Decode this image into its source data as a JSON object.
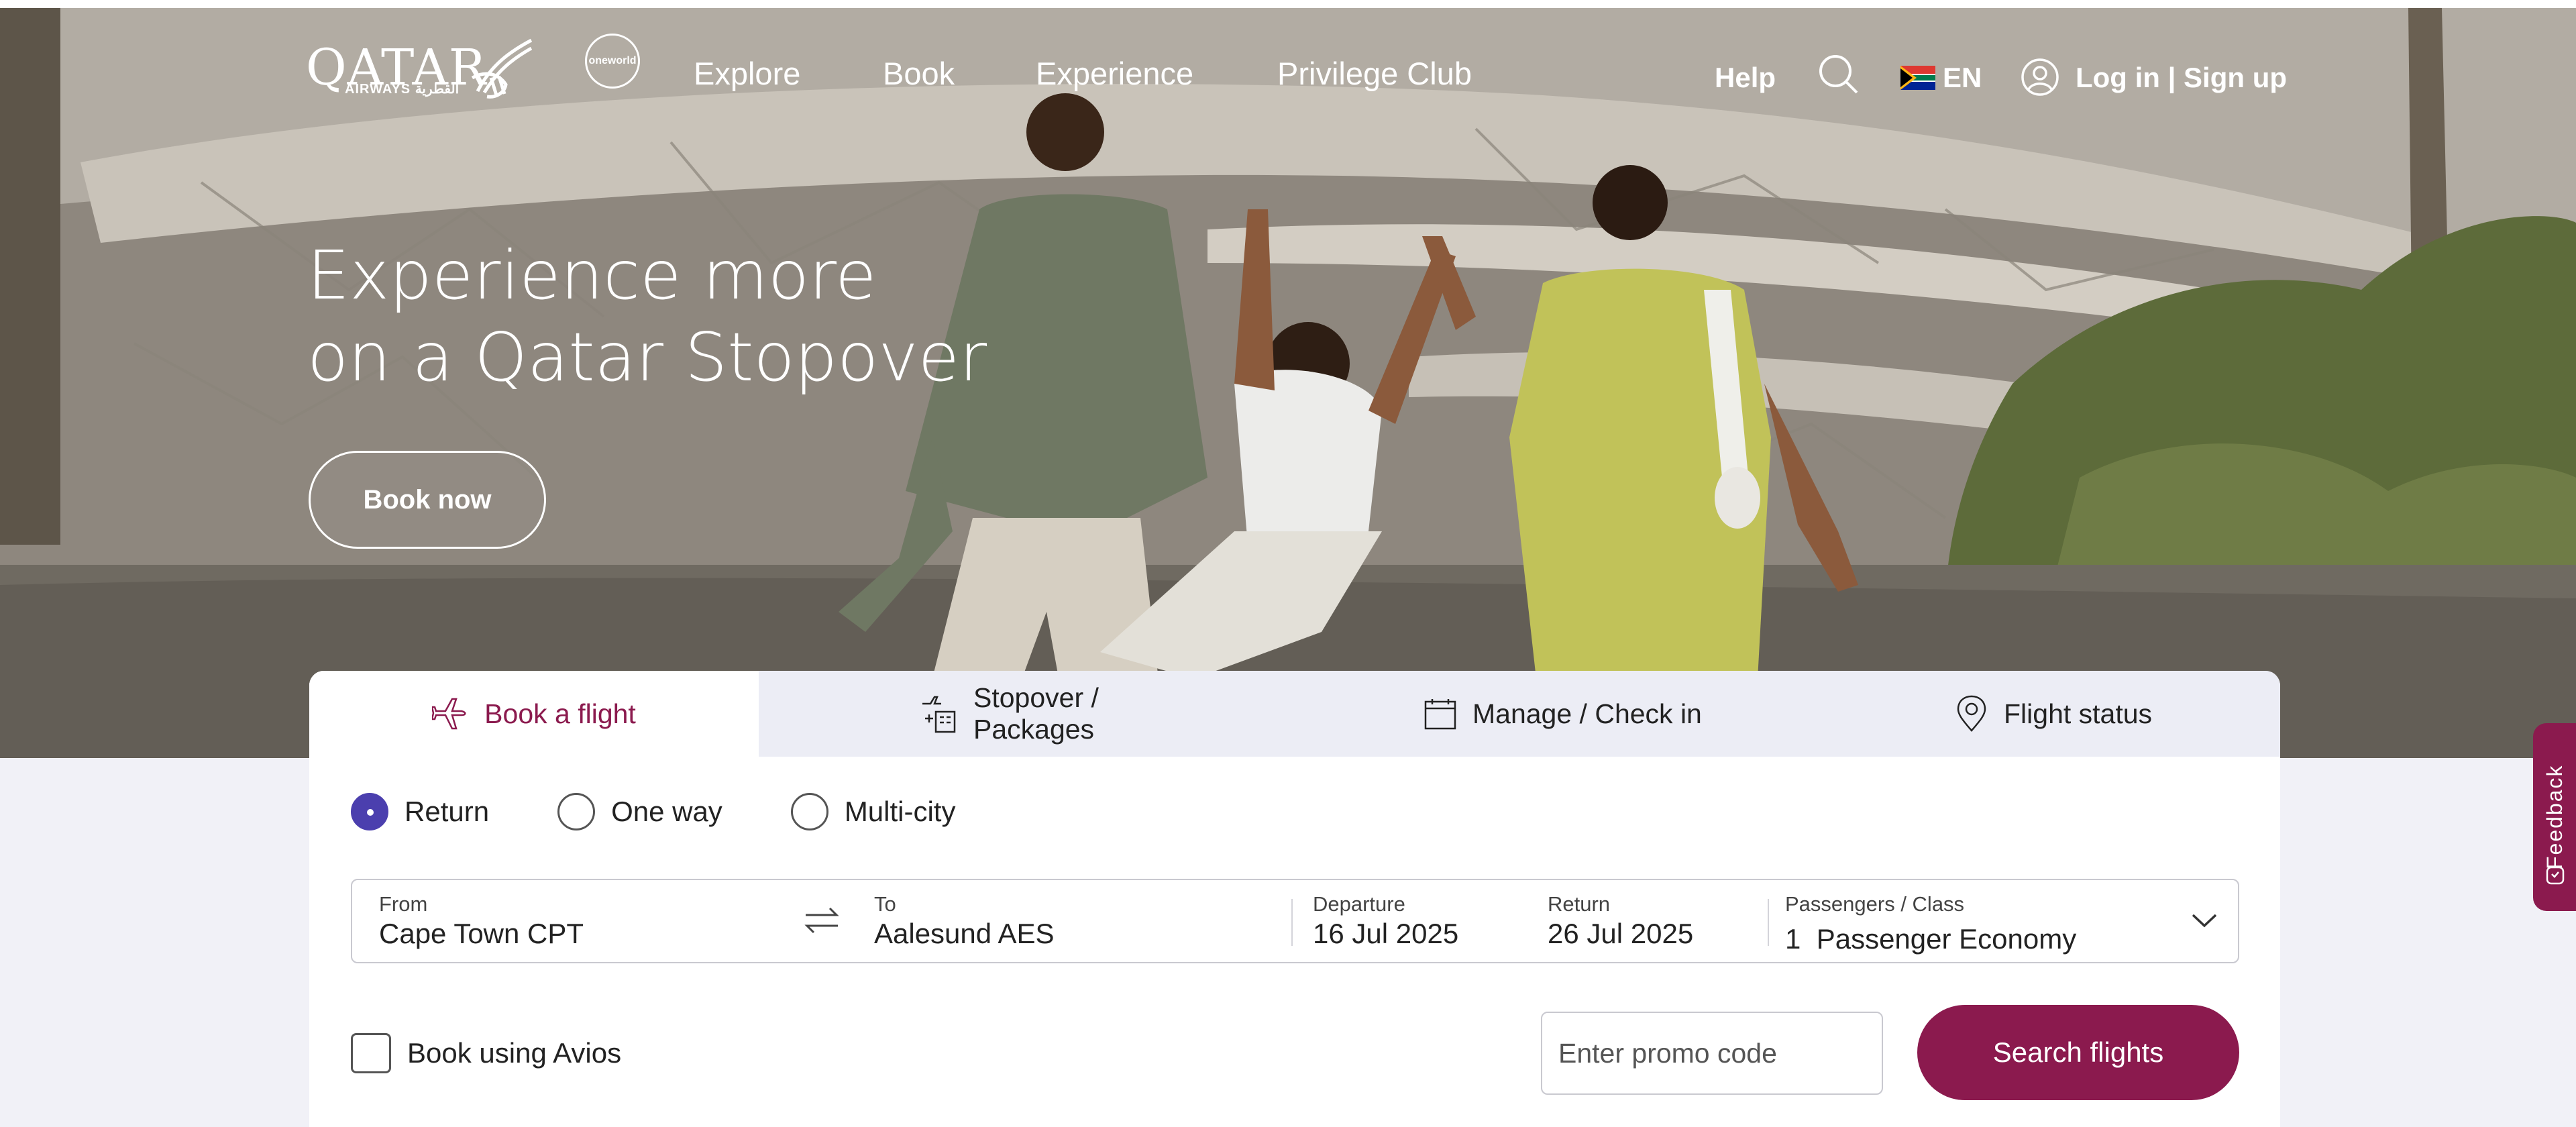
{
  "brand": {
    "name": "QATAR",
    "sub": "AIRWAYS القطرية",
    "alliance": "oneworld"
  },
  "nav": {
    "links": [
      "Explore",
      "Book",
      "Experience",
      "Privilege Club"
    ],
    "help": "Help",
    "language": "EN",
    "login": "Log in | Sign up",
    "icons": [
      "search-icon",
      "south-africa-flag-icon",
      "user-icon"
    ]
  },
  "hero": {
    "title_line1": "Experience more",
    "title_line2": "on a Qatar Stopover",
    "cta": "Book now"
  },
  "booking": {
    "tabs": [
      {
        "label": "Book a flight",
        "icon": "plane-icon",
        "active": true
      },
      {
        "label": "Stopover / Packages",
        "icon": "stopover-icon",
        "active": false
      },
      {
        "label": "Manage / Check in",
        "icon": "calendar-icon",
        "active": false
      },
      {
        "label": "Flight status",
        "icon": "location-pin-icon",
        "active": false
      }
    ],
    "trip_types": [
      "Return",
      "One way",
      "Multi-city"
    ],
    "selected_trip_type": "Return",
    "from": {
      "label": "From",
      "value": "Cape Town CPT"
    },
    "to": {
      "label": "To",
      "value": "Aalesund AES"
    },
    "departure": {
      "label": "Departure",
      "value": "16 Jul 2025"
    },
    "return": {
      "label": "Return",
      "value": "26 Jul 2025"
    },
    "passengers": {
      "label": "Passengers / Class",
      "count": "1",
      "value": "Passenger Economy"
    },
    "avios_label": "Book using Avios",
    "avios_checked": false,
    "promo_placeholder": "Enter promo code",
    "search_label": "Search flights"
  },
  "feedback_label": "Feedback",
  "colors": {
    "brand": "#8b1a4e",
    "radio_selected": "#4b3fae",
    "tab_bar": "#ecedf5",
    "page_bg": "#f1f1f7"
  }
}
